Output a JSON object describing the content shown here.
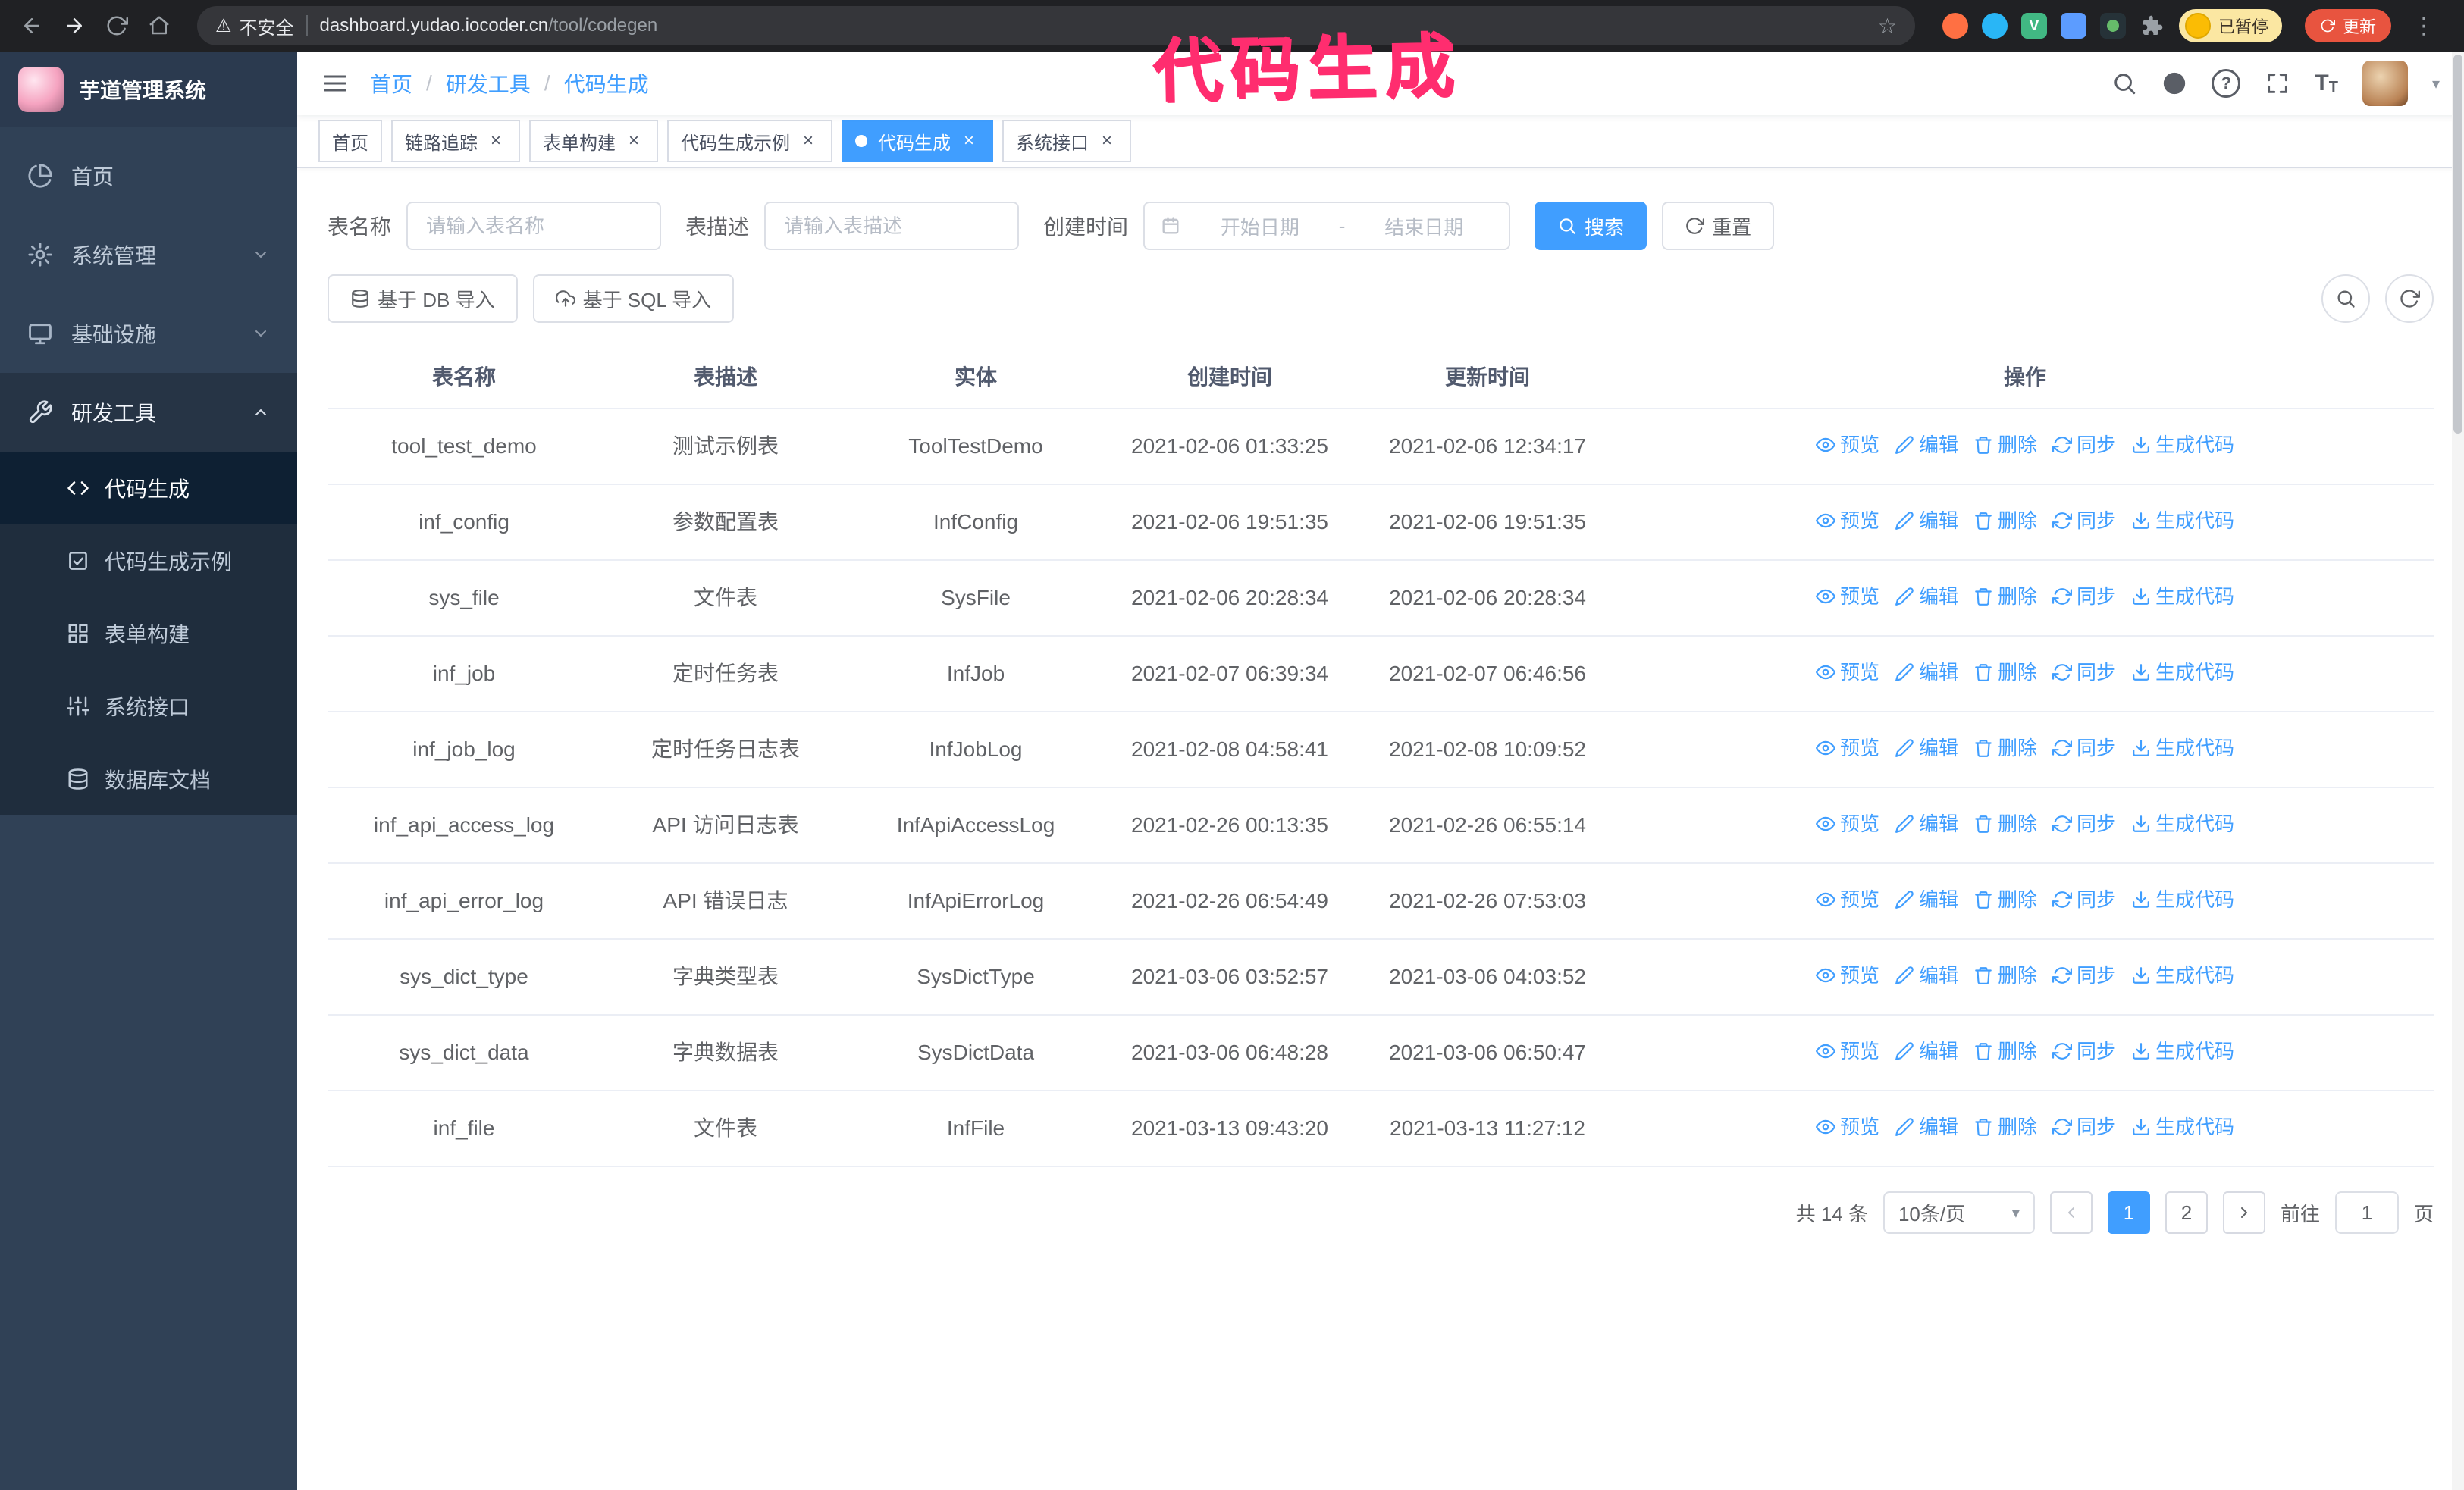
{
  "theme": {
    "accent": "#409eff",
    "sidebar_bg": "#304156",
    "annotation_color": "#ff2d6f"
  },
  "icons": {
    "close": "×",
    "warning": "⚠",
    "star": "☆",
    "more": "⋮",
    "caret": "▾",
    "question": "?",
    "font_large": "T",
    "font_small": "T",
    "vue": "V"
  },
  "browser": {
    "security_label": "不安全",
    "url_host": "dashboard.yudao.iocoder.cn",
    "url_path": "/tool/codegen",
    "profile_badge": "已暂停",
    "update_label": "更新"
  },
  "annotation": {
    "text": "代码生成"
  },
  "sidebar": {
    "logo_title": "芋道管理系统",
    "items": [
      {
        "label": "首页"
      },
      {
        "label": "系统管理"
      },
      {
        "label": "基础设施"
      },
      {
        "label": "研发工具"
      }
    ],
    "subitems": [
      {
        "label": "代码生成"
      },
      {
        "label": "代码生成示例"
      },
      {
        "label": "表单构建"
      },
      {
        "label": "系统接口"
      },
      {
        "label": "数据库文档"
      }
    ]
  },
  "header": {
    "breadcrumb": [
      "首页",
      "研发工具",
      "代码生成"
    ],
    "separator": "/"
  },
  "tabs": [
    {
      "label": "首页"
    },
    {
      "label": "链路追踪"
    },
    {
      "label": "表单构建"
    },
    {
      "label": "代码生成示例"
    },
    {
      "label": "代码生成"
    },
    {
      "label": "系统接口"
    }
  ],
  "filters": {
    "table_name_label": "表名称",
    "table_name_placeholder": "请输入表名称",
    "table_desc_label": "表描述",
    "table_desc_placeholder": "请输入表描述",
    "create_time_label": "创建时间",
    "date_start_placeholder": "开始日期",
    "date_separator": "-",
    "date_end_placeholder": "结束日期",
    "search_label": "搜索",
    "reset_label": "重置"
  },
  "toolbar": {
    "import_db_label": "基于 DB 导入",
    "import_sql_label": "基于 SQL 导入"
  },
  "table": {
    "columns": [
      "表名称",
      "表描述",
      "实体",
      "创建时间",
      "更新时间",
      "操作"
    ],
    "actions": [
      "预览",
      "编辑",
      "删除",
      "同步",
      "生成代码"
    ],
    "rows": [
      {
        "name": "tool_test_demo",
        "desc": "测试示例表",
        "entity": "ToolTestDemo",
        "created": "2021-02-06 01:33:25",
        "updated": "2021-02-06 12:34:17"
      },
      {
        "name": "inf_config",
        "desc": "参数配置表",
        "entity": "InfConfig",
        "created": "2021-02-06 19:51:35",
        "updated": "2021-02-06 19:51:35"
      },
      {
        "name": "sys_file",
        "desc": "文件表",
        "entity": "SysFile",
        "created": "2021-02-06 20:28:34",
        "updated": "2021-02-06 20:28:34"
      },
      {
        "name": "inf_job",
        "desc": "定时任务表",
        "entity": "InfJob",
        "created": "2021-02-07 06:39:34",
        "updated": "2021-02-07 06:46:56"
      },
      {
        "name": "inf_job_log",
        "desc": "定时任务日志表",
        "entity": "InfJobLog",
        "created": "2021-02-08 04:58:41",
        "updated": "2021-02-08 10:09:52"
      },
      {
        "name": "inf_api_access_log",
        "desc": "API 访问日志表",
        "entity": "InfApiAccessLog",
        "created": "2021-02-26 00:13:35",
        "updated": "2021-02-26 06:55:14"
      },
      {
        "name": "inf_api_error_log",
        "desc": "API 错误日志",
        "entity": "InfApiErrorLog",
        "created": "2021-02-26 06:54:49",
        "updated": "2021-02-26 07:53:03"
      },
      {
        "name": "sys_dict_type",
        "desc": "字典类型表",
        "entity": "SysDictType",
        "created": "2021-03-06 03:52:57",
        "updated": "2021-03-06 04:03:52"
      },
      {
        "name": "sys_dict_data",
        "desc": "字典数据表",
        "entity": "SysDictData",
        "created": "2021-03-06 06:48:28",
        "updated": "2021-03-06 06:50:47"
      },
      {
        "name": "inf_file",
        "desc": "文件表",
        "entity": "InfFile",
        "created": "2021-03-13 09:43:20",
        "updated": "2021-03-13 11:27:12"
      }
    ]
  },
  "pagination": {
    "total": "共 14 条",
    "page_size": "10条/页",
    "pages": [
      "1",
      "2"
    ],
    "goto_label": "前往",
    "goto_value": "1",
    "unit_label": "页"
  }
}
